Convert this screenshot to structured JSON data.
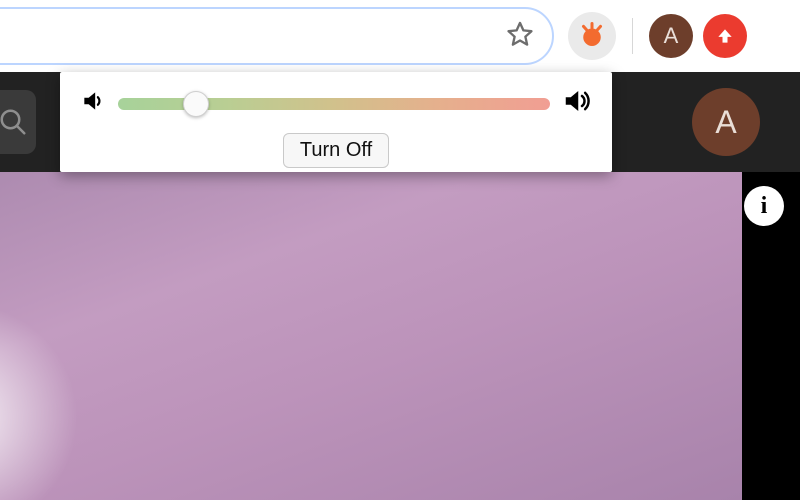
{
  "browser": {
    "omnibox_value": "",
    "avatar_letter": "A"
  },
  "page_header": {
    "avatar_letter": "A"
  },
  "info_badge_letter": "i",
  "popup": {
    "slider_percent": 18,
    "button_label": "Turn Off"
  }
}
